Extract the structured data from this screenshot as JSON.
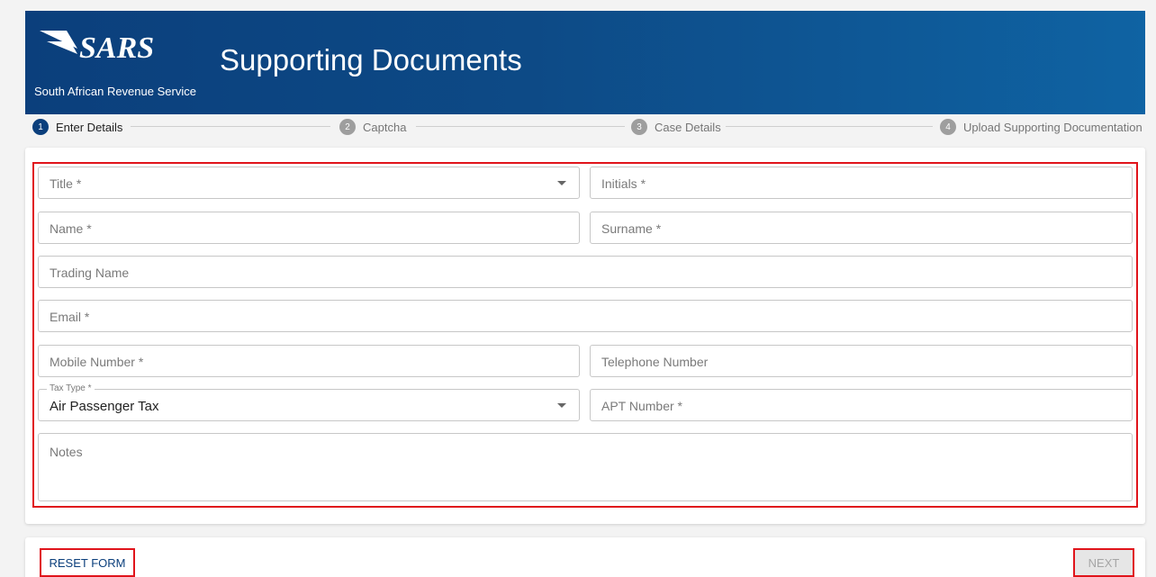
{
  "header": {
    "brand": "SARS",
    "brand_subtitle": "South African Revenue Service",
    "title": "Supporting Documents"
  },
  "stepper": {
    "steps": [
      {
        "number": "1",
        "label": "Enter Details",
        "active": true
      },
      {
        "number": "2",
        "label": "Captcha",
        "active": false
      },
      {
        "number": "3",
        "label": "Case Details",
        "active": false
      },
      {
        "number": "4",
        "label": "Upload Supporting Documentation",
        "active": false
      }
    ]
  },
  "form": {
    "title_placeholder": "Title *",
    "initials_placeholder": "Initials *",
    "name_placeholder": "Name *",
    "surname_placeholder": "Surname *",
    "trading_name_placeholder": "Trading Name",
    "email_placeholder": "Email *",
    "mobile_placeholder": "Mobile Number *",
    "telephone_placeholder": "Telephone Number",
    "tax_type_label": "Tax Type *",
    "tax_type_value": "Air Passenger Tax",
    "apt_number_placeholder": "APT Number *",
    "notes_placeholder": "Notes"
  },
  "actions": {
    "reset_label": "RESET FORM",
    "next_label": "NEXT"
  },
  "colors": {
    "header_dark": "#0b3f7c",
    "header_light": "#0f63a3",
    "highlight": "#e0141b",
    "active_step": "#0b3f7c"
  }
}
